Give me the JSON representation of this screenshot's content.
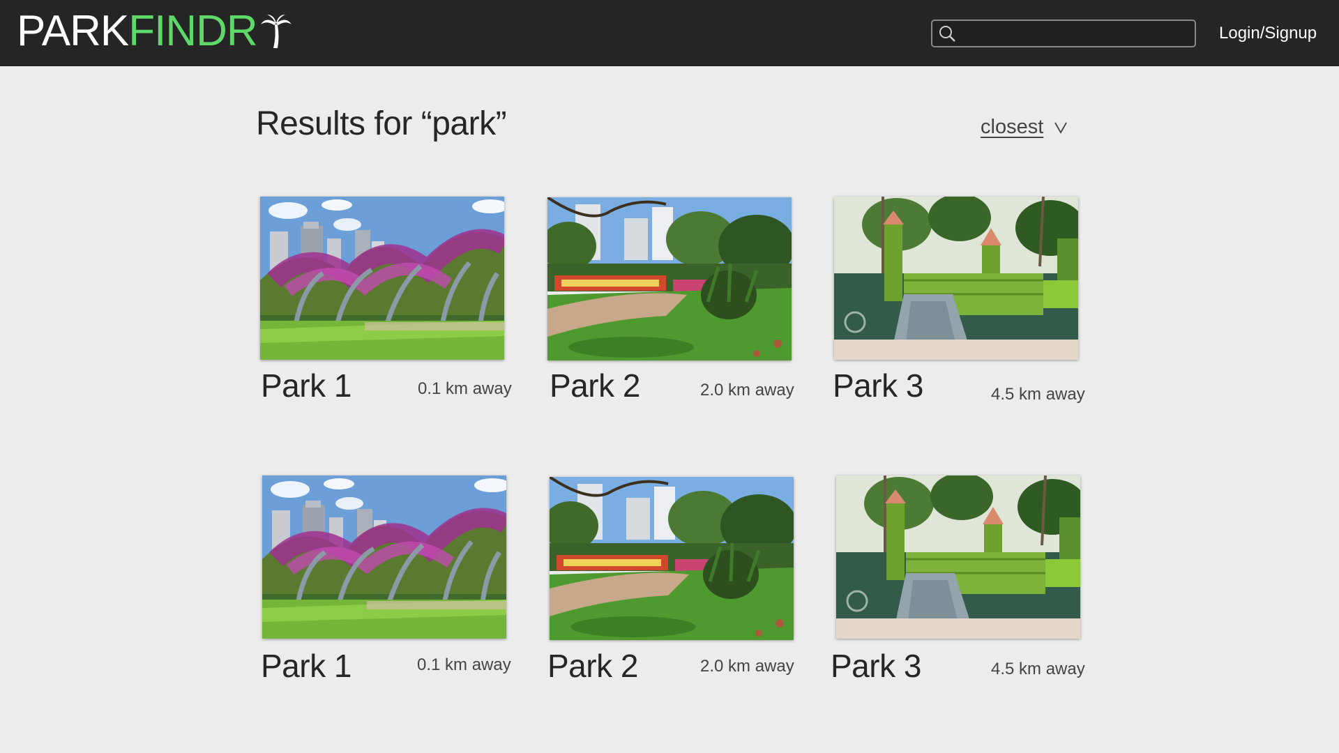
{
  "header": {
    "logo_part1": "PARK",
    "logo_part2": "FINDR",
    "search_placeholder": "",
    "login_label": "Login/Signup",
    "logo_icon": "palm-tree-icon",
    "search_icon": "search-icon"
  },
  "main": {
    "results_title": "Results for “park”",
    "sort_label": "closest",
    "sort_icon": "chevron-down-icon"
  },
  "results": [
    {
      "name": "Park 1",
      "distance": "0.1 km away",
      "image": "bougainvillea-arbour-photo"
    },
    {
      "name": "Park 2",
      "distance": "2.0 km away",
      "image": "garden-lawn-photo"
    },
    {
      "name": "Park 3",
      "distance": "4.5 km away",
      "image": "playground-photo"
    },
    {
      "name": "Park 1",
      "distance": "0.1 km away",
      "image": "bougainvillea-arbour-photo"
    },
    {
      "name": "Park 2",
      "distance": "2.0 km away",
      "image": "garden-lawn-photo"
    },
    {
      "name": "Park 3",
      "distance": "4.5 km away",
      "image": "playground-photo"
    }
  ],
  "colors": {
    "topbar": "#252525",
    "background": "#ececec",
    "brand_green": "#5fd86a",
    "text_dark": "#262626"
  }
}
